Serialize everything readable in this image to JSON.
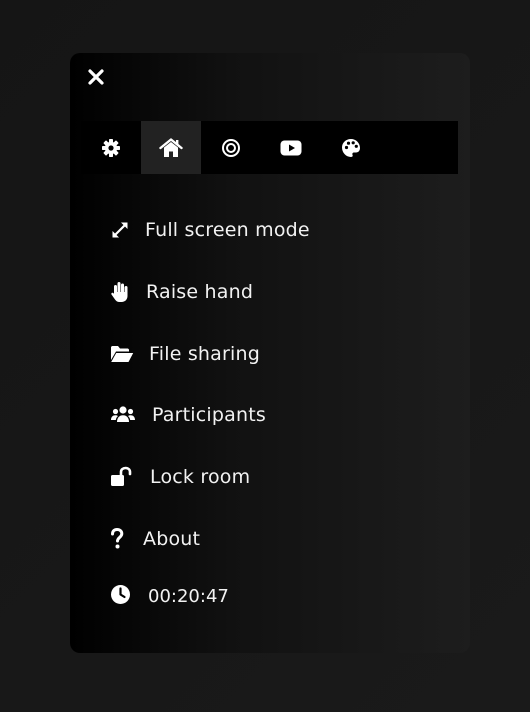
{
  "menu": {
    "close_icon": "close-icon",
    "tabs": [
      {
        "icon": "gear-icon",
        "active": false
      },
      {
        "icon": "home-icon",
        "active": true
      },
      {
        "icon": "record-icon",
        "active": false
      },
      {
        "icon": "youtube-icon",
        "active": false
      },
      {
        "icon": "palette-icon",
        "active": false
      }
    ],
    "items": [
      {
        "icon": "expand-icon",
        "label": "Full screen mode"
      },
      {
        "icon": "hand-icon",
        "label": "Raise hand"
      },
      {
        "icon": "folder-open-icon",
        "label": "File sharing"
      },
      {
        "icon": "users-icon",
        "label": "Participants"
      },
      {
        "icon": "unlock-icon",
        "label": "Lock room"
      },
      {
        "icon": "question-icon",
        "label": "About"
      }
    ],
    "timer": {
      "icon": "clock-icon",
      "value": "00:20:47"
    }
  },
  "colors": {
    "background": "#171717",
    "panel": "#111111",
    "tab_bar": "#000000",
    "tab_active": "#222222",
    "text": "#f2f2f2"
  }
}
